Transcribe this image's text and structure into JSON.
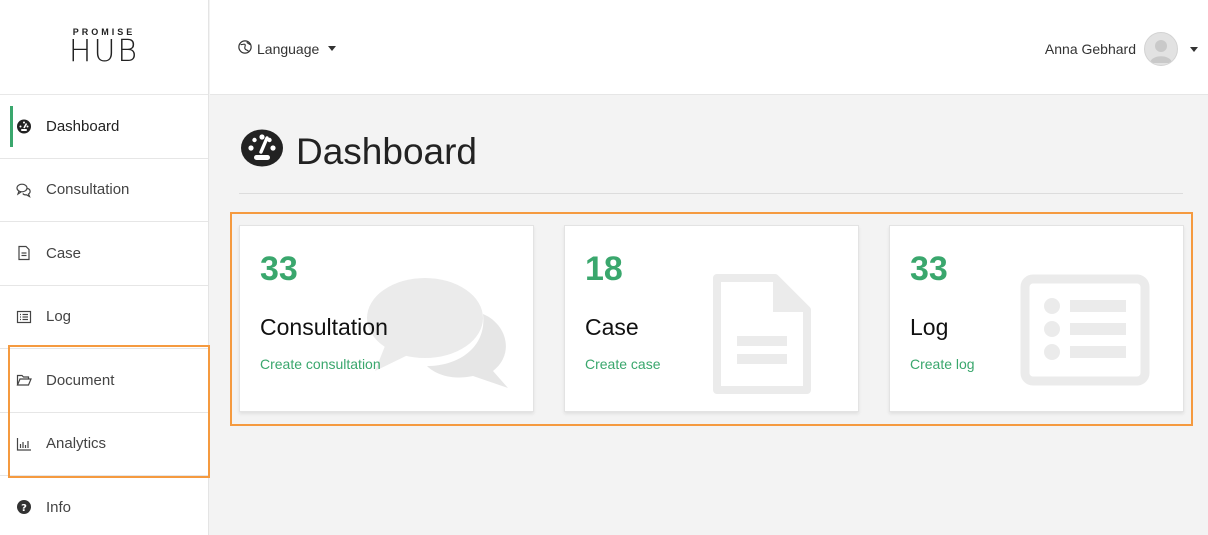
{
  "logo": {
    "top": "PROMISE",
    "main": "HUB"
  },
  "sidebar": {
    "items": [
      {
        "label": "Dashboard",
        "icon": "tachometer-icon"
      },
      {
        "label": "Consultation",
        "icon": "comments-icon"
      },
      {
        "label": "Case",
        "icon": "file-icon"
      },
      {
        "label": "Log",
        "icon": "list-icon"
      },
      {
        "label": "Document",
        "icon": "folder-open-icon"
      },
      {
        "label": "Analytics",
        "icon": "bar-chart-icon"
      },
      {
        "label": "Info",
        "icon": "question-circle-icon"
      }
    ]
  },
  "topbar": {
    "language_label": "Language",
    "user_name": "Anna Gebhard"
  },
  "main": {
    "title": "Dashboard",
    "cards": [
      {
        "count": "33",
        "title": "Consultation",
        "link": "Create consultation",
        "icon": "comments-icon"
      },
      {
        "count": "18",
        "title": "Case",
        "link": "Create case",
        "icon": "file-icon"
      },
      {
        "count": "33",
        "title": "Log",
        "link": "Create log",
        "icon": "list-icon"
      }
    ]
  },
  "colors": {
    "accent": "#3aa76d",
    "highlight": "#f59a3f"
  }
}
